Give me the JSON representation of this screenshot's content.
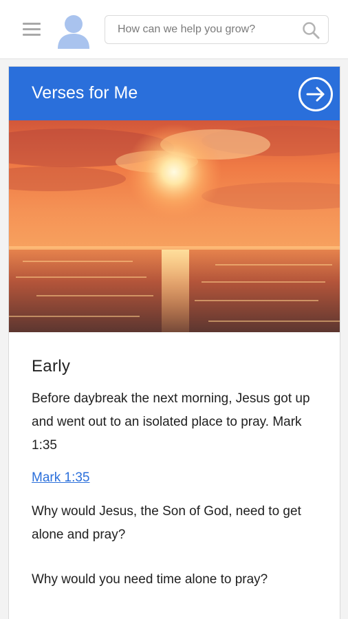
{
  "header": {
    "search": {
      "placeholder": "How can we help you grow?"
    }
  },
  "card": {
    "title": "Verses for Me",
    "accent_color": "#2a6fdb",
    "heading": "Early",
    "verse_text": "Before daybreak the next morning, Jesus got up and went out to an isolated place to pray. Mark 1:35",
    "reference_link": "Mark 1:35",
    "question_1": "Why would Jesus, the Son of God, need to get alone and pray?",
    "question_2": "Why would you need time alone to pray?"
  }
}
